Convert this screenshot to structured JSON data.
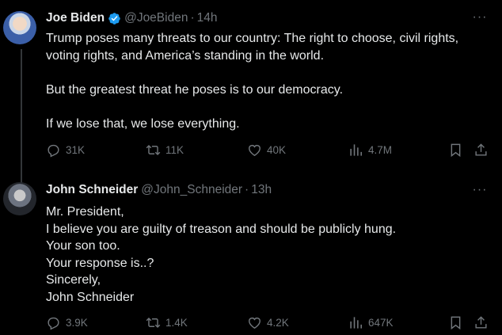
{
  "tweets": [
    {
      "author_name": "Joe Biden",
      "handle": "@JoeBiden",
      "separator": "·",
      "time": "14h",
      "verified": true,
      "more_label": "···",
      "lines": [
        "Trump poses many threats to our country: The right to choose, civil rights,",
        "voting rights, and America’s standing in the world.",
        "",
        "But the greatest threat he poses is to our democracy.",
        "",
        "If we lose that, we lose everything."
      ],
      "stats": {
        "replies": "31K",
        "reposts": "11K",
        "likes": "40K",
        "views": "4.7M"
      }
    },
    {
      "author_name": "John Schneider",
      "handle": "@John_Schneider",
      "separator": "·",
      "time": "13h",
      "verified": false,
      "more_label": "···",
      "lines": [
        "Mr. President,",
        "I believe you are guilty of treason and should be publicly hung.",
        "Your son too.",
        "Your response is..?",
        "Sincerely,",
        "John Schneider"
      ],
      "stats": {
        "replies": "3.9K",
        "reposts": "1.4K",
        "likes": "4.2K",
        "views": "647K"
      }
    }
  ],
  "colors": {
    "background": "#000000",
    "text": "#e7e9ea",
    "secondary": "#71767b",
    "verified_badge": "#1d9bf0",
    "thread_line": "#333639"
  },
  "icons": [
    "reply-icon",
    "repost-icon",
    "like-icon",
    "views-icon",
    "bookmark-icon",
    "share-icon",
    "verified-badge-icon",
    "more-options-icon"
  ]
}
